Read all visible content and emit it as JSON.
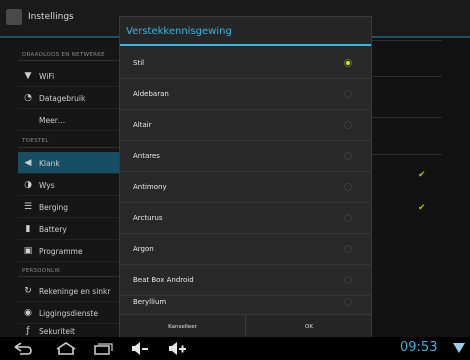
{
  "app": {
    "title": "Instellings"
  },
  "sidebar": {
    "sections": [
      {
        "header": "DRAADLOOS EN NETWERKE"
      },
      {
        "header": "TOESTEL"
      },
      {
        "header": "PERSOONLIK"
      }
    ],
    "items": [
      {
        "label": "WiFi",
        "icon": "wifi-icon"
      },
      {
        "label": "Datagebruik",
        "icon": "data-usage-icon"
      },
      {
        "label": "Meer…",
        "icon": ""
      },
      {
        "label": "Klank",
        "icon": "volume-icon",
        "selected": true
      },
      {
        "label": "Wys",
        "icon": "display-icon"
      },
      {
        "label": "Berging",
        "icon": "storage-icon"
      },
      {
        "label": "Battery",
        "icon": "battery-icon"
      },
      {
        "label": "Programme",
        "icon": "apps-icon"
      },
      {
        "label": "Rekeninge en sinkr",
        "icon": "sync-icon"
      },
      {
        "label": "Liggingsdienste",
        "icon": "location-icon"
      },
      {
        "label": "Sekuriteit",
        "icon": "security-icon"
      }
    ]
  },
  "dialog": {
    "title": "Verstekkennisgewing",
    "selected_index": 0,
    "options": [
      {
        "label": "Stil"
      },
      {
        "label": "Aldebaran"
      },
      {
        "label": "Altair"
      },
      {
        "label": "Antares"
      },
      {
        "label": "Antimony"
      },
      {
        "label": "Arcturus"
      },
      {
        "label": "Argon"
      },
      {
        "label": "Beat Box Android"
      },
      {
        "label": "Beryllium"
      }
    ],
    "cancel_label": "Kanselleer",
    "ok_label": "OK"
  },
  "status": {
    "time": "09:53"
  },
  "colors": {
    "accent": "#33b5e5",
    "radio_on": "#cfe61a",
    "check": "#99cc00",
    "selected_row": "#164e63"
  }
}
